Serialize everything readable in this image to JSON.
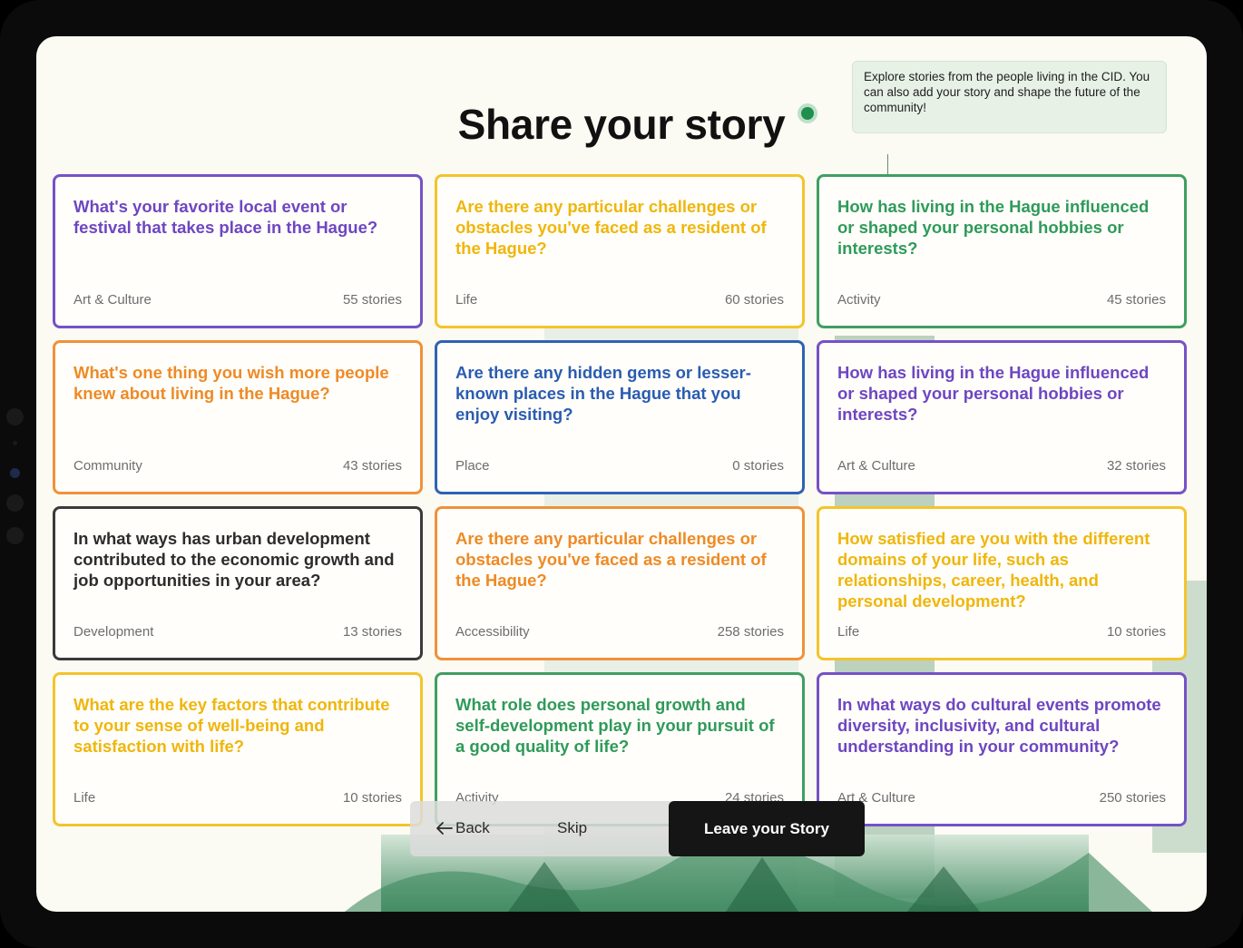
{
  "header": {
    "title": "Share your story",
    "tooltip": "Explore stories from the people living in the CID. You can also add your story and shape the future of the community!"
  },
  "colors": {
    "purple": "#6e46c2",
    "yellow": "#efb60c",
    "green": "#2f9a5a",
    "orange": "#ee8a26",
    "blue": "#2a5cb1",
    "dark": "#2c2c2c",
    "primary_button": "#151515"
  },
  "cards": [
    {
      "question": "What's your favorite local event or festival that takes place in the Hague?",
      "category": "Art & Culture",
      "count": "55 stories",
      "color": "purple"
    },
    {
      "question": "Are there any particular challenges or obstacles you've faced as a resident of the Hague?",
      "category": "Life",
      "count": "60 stories",
      "color": "yellow"
    },
    {
      "question": "How has living in the Hague influenced or shaped your personal hobbies or interests?",
      "category": "Activity",
      "count": "45 stories",
      "color": "green"
    },
    {
      "question": "What's one thing you wish more people knew about living in the Hague?",
      "category": "Community",
      "count": "43 stories",
      "color": "orange"
    },
    {
      "question": "Are there any hidden gems or lesser-known places in the Hague that you enjoy visiting?",
      "category": "Place",
      "count": "0 stories",
      "color": "blue"
    },
    {
      "question": "How has living in the Hague influenced or shaped your personal hobbies or interests?",
      "category": "Art & Culture",
      "count": "32 stories",
      "color": "purple"
    },
    {
      "question": "In what ways has urban development contributed to the economic growth and job opportunities in your area?",
      "category": "Development",
      "count": "13 stories",
      "color": "dark"
    },
    {
      "question": "Are there any particular challenges or obstacles you've faced as a resident of the Hague?",
      "category": "Accessibility",
      "count": "258 stories",
      "color": "orange"
    },
    {
      "question": "How satisfied are you with the different domains of your life, such as relationships, career, health, and personal development?",
      "category": "Life",
      "count": "10 stories",
      "color": "yellow"
    },
    {
      "question": "What are the key factors that contribute to your sense of well-being and satisfaction with life?",
      "category": "Life",
      "count": "10 stories",
      "color": "yellow"
    },
    {
      "question": "What role does personal growth and self-development play in your pursuit of a good quality of life?",
      "category": "Activity",
      "count": "24 stories",
      "color": "green"
    },
    {
      "question": "In what ways do cultural events promote diversity, inclusivity, and cultural understanding in your community?",
      "category": "Art & Culture",
      "count": "250 stories",
      "color": "purple"
    }
  ],
  "actions": {
    "back_label": "Back",
    "back_icon": "arrow-left-icon",
    "skip_label": "Skip",
    "leave_label": "Leave your Story"
  }
}
